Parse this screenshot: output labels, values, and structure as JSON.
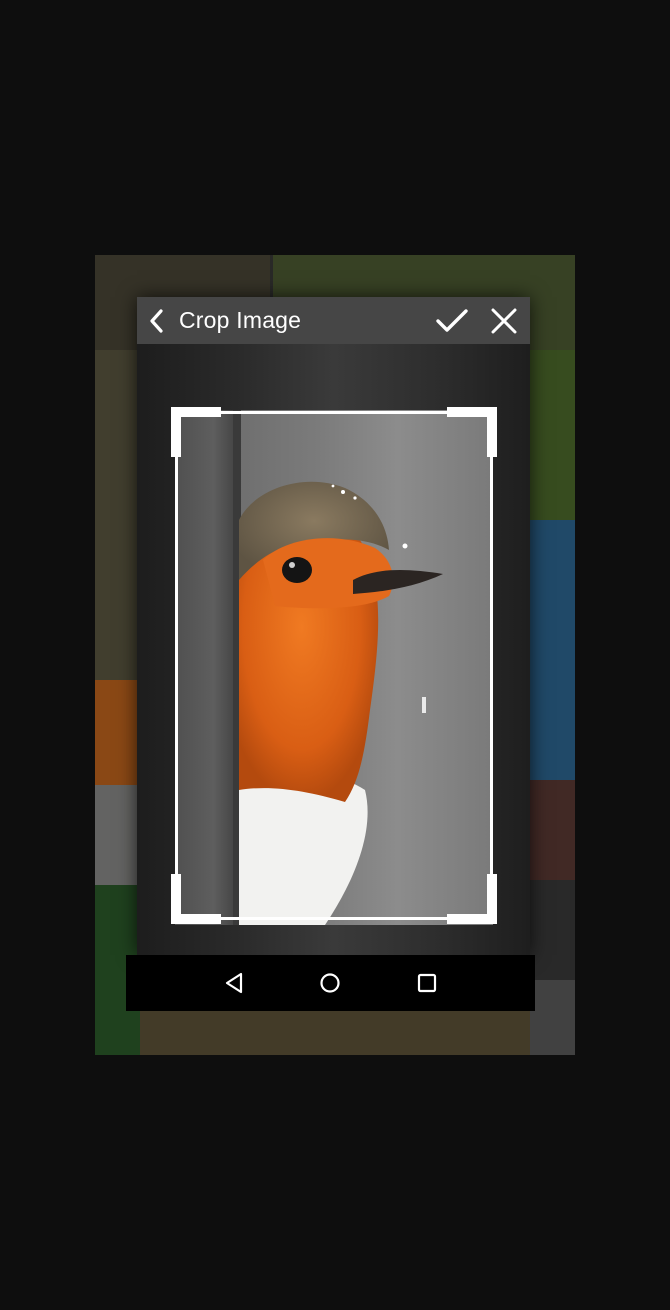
{
  "toolbar": {
    "title": "Crop Image",
    "back_icon": "chevron-left-icon",
    "confirm_icon": "check-icon",
    "close_icon": "close-icon"
  },
  "navbar": {
    "back_icon": "nav-back-triangle-icon",
    "home_icon": "nav-home-circle-icon",
    "recents_icon": "nav-recents-square-icon"
  },
  "colors": {
    "page_background": "#0e0e0e",
    "toolbar": "#464646",
    "navbar": "#000000",
    "crop_frame": "#ffffff",
    "bird_orange": "#e2691c"
  }
}
